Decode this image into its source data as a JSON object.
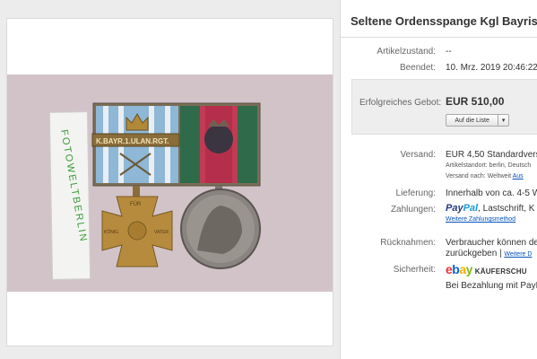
{
  "listing": {
    "title": "Seltene Ordensspange Kgl Bayris"
  },
  "photo": {
    "card_text": "FOTOWELTBERLIN",
    "clasp_text": "K.BAYR.1.ULAN.RGT.",
    "cross_text_top": "FÜR",
    "cross_text_left": "KÖNIG",
    "cross_text_right": "VATER",
    "colors": {
      "background": "#d2c3c9",
      "ribbon_blue": "#8fb7d6",
      "ribbon_green": "#2f6b4a",
      "ribbon_red": "#c23a54",
      "gold": "#b68b3e"
    }
  },
  "details": {
    "condition_label": "Artikelzustand:",
    "condition_value": "--",
    "ended_label": "Beendet:",
    "ended_value": "10. Mrz. 2019  20:46:22",
    "bid_label": "Erfolgreiches Gebot:",
    "bid_value": "EUR 510,00",
    "watch_button": "Auf die Liste",
    "shipping_label": "Versand:",
    "shipping_value": "EUR 4,50  Standardversa",
    "item_location": "Artikelstandort:  berlin, Deutsch",
    "ships_to_prefix": "Versand nach:  Weltweit  ",
    "ships_to_link": "Aus",
    "delivery_label": "Lieferung:",
    "delivery_value": "Innerhalb von ca. 4-5 We",
    "payment_label": "Zahlungen:",
    "paypal_part1": "Pay",
    "paypal_part2": "Pal",
    "payment_methods": ",  Lastschrift,  K",
    "payment_more_link": "Weitere Zahlungsmethod",
    "returns_label": "Rücknahmen:",
    "returns_value_line1": "Verbraucher können den",
    "returns_value_line2": "zurückgeben |  ",
    "returns_more_link": "Weitere D",
    "security_label": "Sicherheit:",
    "ebay_e": "e",
    "ebay_b": "b",
    "ebay_a": "a",
    "ebay_y": "y",
    "kaeuferschutz": "KÄUFERSCHU",
    "paypal_purchase": "Bei Bezahlung mit PayP"
  }
}
